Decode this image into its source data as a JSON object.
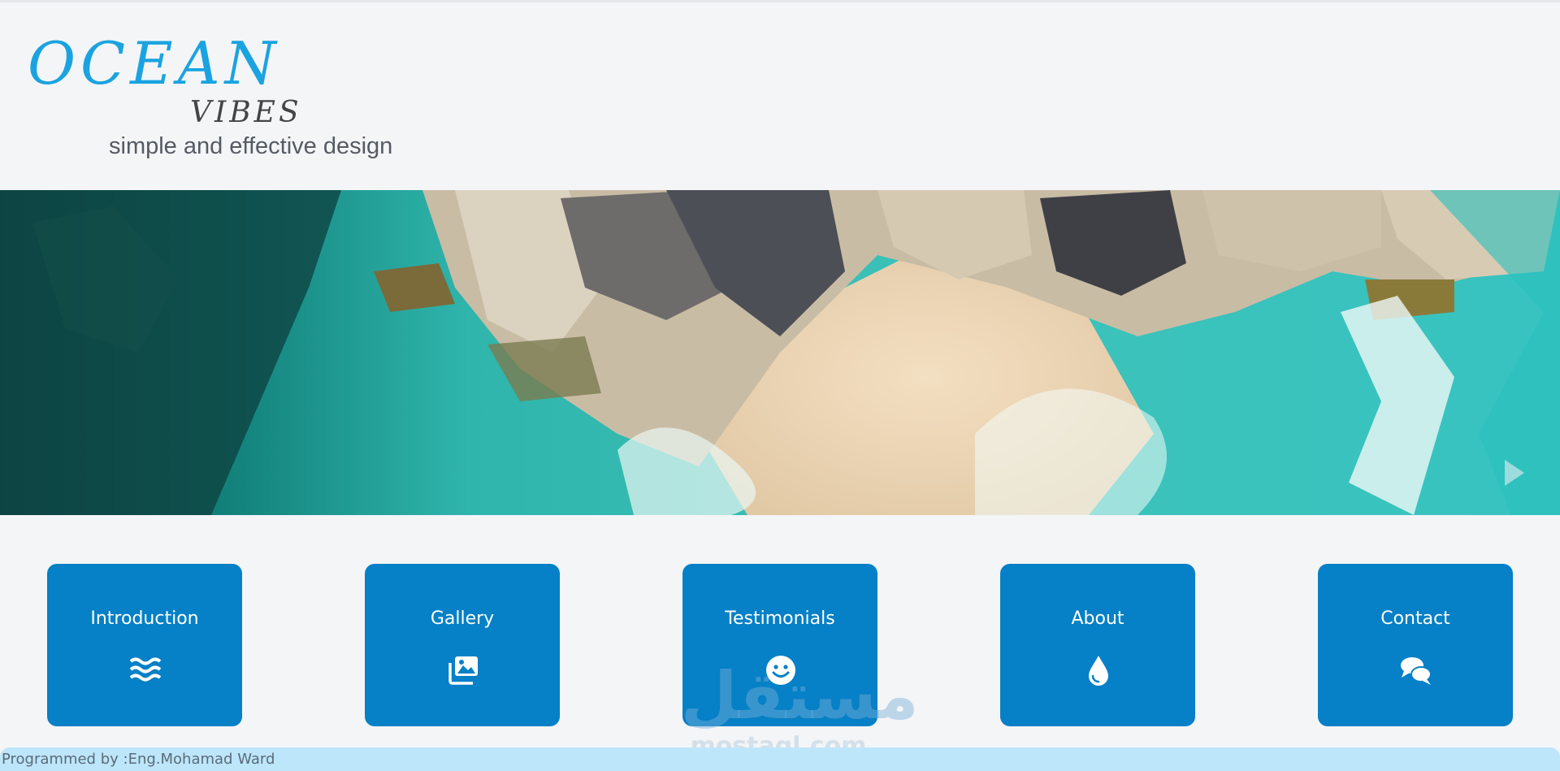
{
  "brand": {
    "title": "OCEAN",
    "subtitle": "VIBES",
    "tagline": "simple and effective design"
  },
  "hero": {
    "play_icon": "play-icon"
  },
  "cards": [
    {
      "label": "Introduction",
      "icon": "waves-icon"
    },
    {
      "label": "Gallery",
      "icon": "images-icon"
    },
    {
      "label": "Testimonials",
      "icon": "smile-icon"
    },
    {
      "label": "About",
      "icon": "water-drop-icon"
    },
    {
      "label": "Contact",
      "icon": "comments-icon"
    }
  ],
  "watermark": {
    "arabic": "مستقل",
    "latin": "mostaql.com"
  },
  "footer": {
    "credit": "Programmed by :Eng.Mohamad Ward"
  },
  "colors": {
    "brand_blue": "#1aa3e0",
    "card_blue": "#0680c6",
    "footer_bg": "#bde6fb",
    "page_bg": "#f4f5f7"
  }
}
